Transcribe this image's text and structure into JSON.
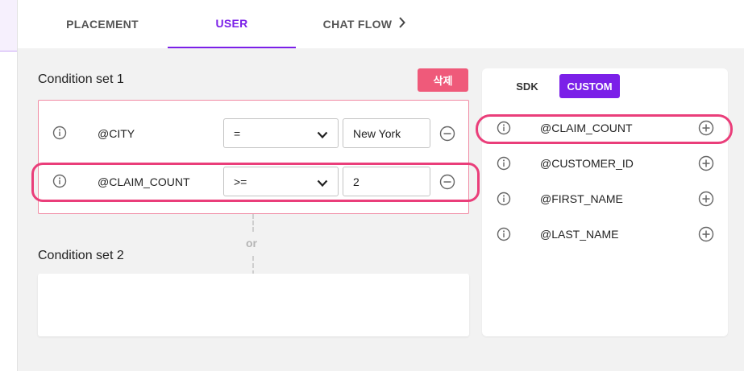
{
  "tabs": [
    {
      "label": "PLACEMENT"
    },
    {
      "label": "USER"
    },
    {
      "label": "CHAT FLOW"
    }
  ],
  "active_tab": "USER",
  "accent_color": "#7b20e8",
  "highlight_color": "#ea3e7a",
  "delete_button_color": "#ef5a7a",
  "icons": {
    "chat_flow_chevron": "chevron-right-icon",
    "info": "info-circle-icon",
    "remove": "minus-circle-icon",
    "add": "plus-circle-icon",
    "select_chevron": "chevron-down-icon"
  },
  "condition_sets": [
    {
      "title": "Condition set 1",
      "delete_label": "삭제",
      "conditions": [
        {
          "variable": "@CITY",
          "operator": "=",
          "value": "New York"
        },
        {
          "variable": "@CLAIM_COUNT",
          "operator": ">=",
          "value": "2"
        }
      ]
    },
    {
      "title": "Condition set 2",
      "conditions": []
    }
  ],
  "connector_label": "or",
  "variables_panel": {
    "tabs": [
      {
        "label": "SDK"
      },
      {
        "label": "CUSTOM"
      }
    ],
    "active_tab": "CUSTOM",
    "items": [
      {
        "label": "@CLAIM_COUNT"
      },
      {
        "label": "@CUSTOMER_ID"
      },
      {
        "label": "@FIRST_NAME"
      },
      {
        "label": "@LAST_NAME"
      }
    ]
  }
}
